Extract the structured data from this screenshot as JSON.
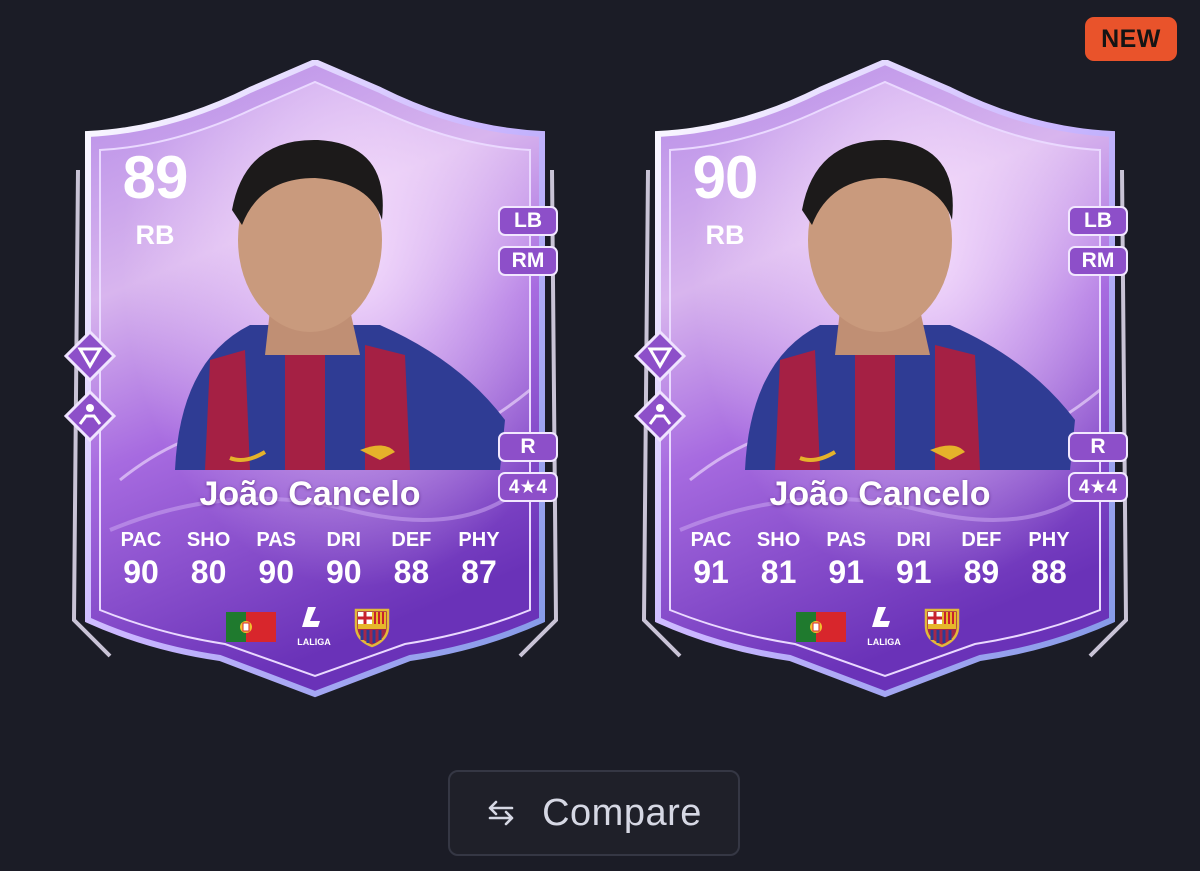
{
  "badge": {
    "label": "NEW"
  },
  "cards": [
    {
      "rating": "89",
      "position": "RB",
      "alt_positions": [
        "LB",
        "RM"
      ],
      "preferred_foot": "R",
      "skill_weak": "4★4",
      "name": "João Cancelo",
      "stats": [
        {
          "label": "PAC",
          "value": "90"
        },
        {
          "label": "SHO",
          "value": "80"
        },
        {
          "label": "PAS",
          "value": "90"
        },
        {
          "label": "DRI",
          "value": "90"
        },
        {
          "label": "DEF",
          "value": "88"
        },
        {
          "label": "PHY",
          "value": "87"
        }
      ],
      "nation_icon": "portugal-flag-icon",
      "league": {
        "name": "LALIGA",
        "icon": "laliga-logo-icon"
      },
      "club_icon": "fc-barcelona-crest-icon"
    },
    {
      "rating": "90",
      "position": "RB",
      "alt_positions": [
        "LB",
        "RM"
      ],
      "preferred_foot": "R",
      "skill_weak": "4★4",
      "name": "João Cancelo",
      "stats": [
        {
          "label": "PAC",
          "value": "91"
        },
        {
          "label": "SHO",
          "value": "81"
        },
        {
          "label": "PAS",
          "value": "91"
        },
        {
          "label": "DRI",
          "value": "91"
        },
        {
          "label": "DEF",
          "value": "89"
        },
        {
          "label": "PHY",
          "value": "88"
        }
      ],
      "nation_icon": "portugal-flag-icon",
      "league": {
        "name": "LALIGA",
        "icon": "laliga-logo-icon"
      },
      "club_icon": "fc-barcelona-crest-icon"
    }
  ],
  "compare_button": {
    "label": "Compare",
    "icon": "swap-arrows-icon"
  },
  "colors": {
    "background": "#1b1c26",
    "badge": "#e9532b",
    "card_purple": "#8d4fc9",
    "button_border": "#353744"
  }
}
